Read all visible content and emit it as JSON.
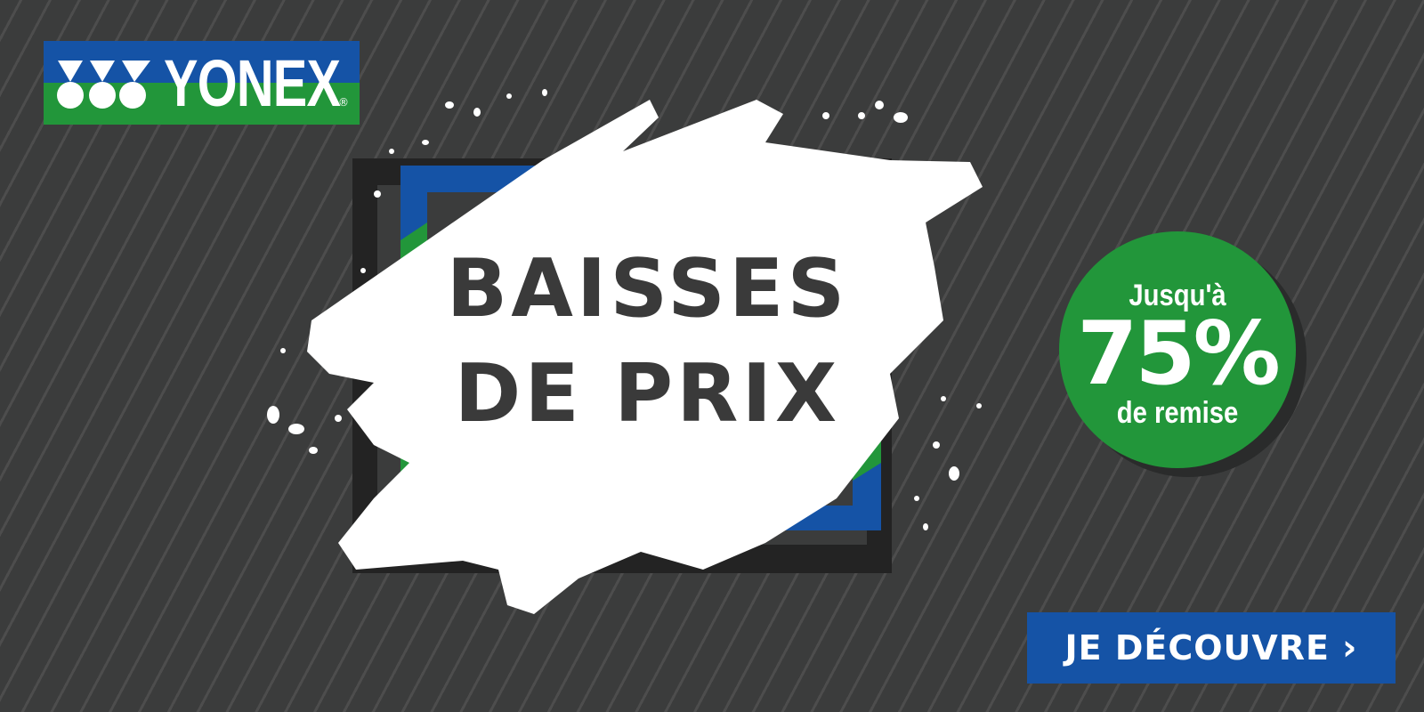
{
  "brand": {
    "name": "YONEX",
    "reg_mark": "®",
    "colors": {
      "blue": "#1553a6",
      "green": "#22963a",
      "background": "#3b3c3c"
    }
  },
  "headline": {
    "line1": "BAISSES",
    "line2": "DE PRIX"
  },
  "badge": {
    "top": "Jusqu'à",
    "value": "75%",
    "bottom": "de remise"
  },
  "cta": {
    "label": "JE DÉCOUVRE",
    "icon": "chevron-right-icon"
  }
}
